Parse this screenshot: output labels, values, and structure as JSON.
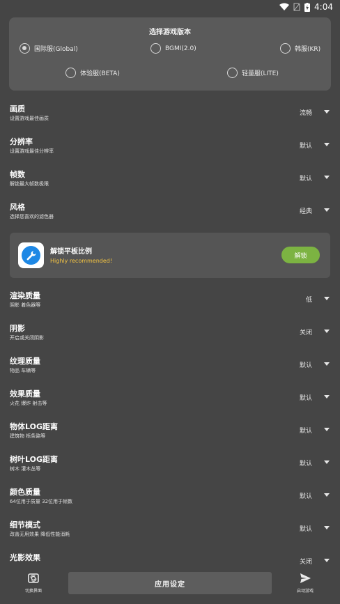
{
  "statusbar": {
    "time": "4:04"
  },
  "version_panel": {
    "title": "选择游戏版本",
    "options": [
      {
        "label": "国际服(Global)",
        "checked": true
      },
      {
        "label": "BGMI(2.0)",
        "checked": false
      },
      {
        "label": "韩服(KR)",
        "checked": false
      },
      {
        "label": "体验服(BETA)",
        "checked": false
      },
      {
        "label": "轻量服(LITE)",
        "checked": false
      }
    ]
  },
  "settings_top": [
    {
      "title": "画质",
      "desc": "设置游戏最佳画质",
      "value": "流畅"
    },
    {
      "title": "分辨率",
      "desc": "设置游戏最佳分辨率",
      "value": "默认"
    },
    {
      "title": "帧数",
      "desc": "解锁最大帧数极限",
      "value": "默认"
    },
    {
      "title": "风格",
      "desc": "选择您喜欢的滤色器",
      "value": "经典"
    }
  ],
  "promo": {
    "title": "解锁平板比例",
    "subtitle": "Highly recommended!",
    "button": "解锁",
    "icon": "wrench-icon",
    "accent": "#7cb342"
  },
  "settings_bottom": [
    {
      "title": "渲染质量",
      "desc": "阴影 着色器等",
      "value": "低"
    },
    {
      "title": "阴影",
      "desc": "开启或关闭阴影",
      "value": "关闭"
    },
    {
      "title": "纹理质量",
      "desc": "物品 车辆等",
      "value": "默认"
    },
    {
      "title": "效果质量",
      "desc": "火花 爆炸 射击等",
      "value": "默认"
    },
    {
      "title": "物体LOG距离",
      "desc": "建筑物 栎条路等",
      "value": "默认"
    },
    {
      "title": "树叶LOG距离",
      "desc": "树木 灌木丛等",
      "value": "默认"
    },
    {
      "title": "颜色质量",
      "desc": "64位用于质量 32位用于帧数",
      "value": "默认"
    },
    {
      "title": "细节模式",
      "desc": "改善无用效果 降低性能消耗",
      "value": "默认"
    },
    {
      "title": "光影效果",
      "desc": "",
      "value": "关闭"
    }
  ],
  "bottombar": {
    "switch_label": "切换界面",
    "apply_label": "应用设定",
    "launch_label": "启动游戏"
  }
}
